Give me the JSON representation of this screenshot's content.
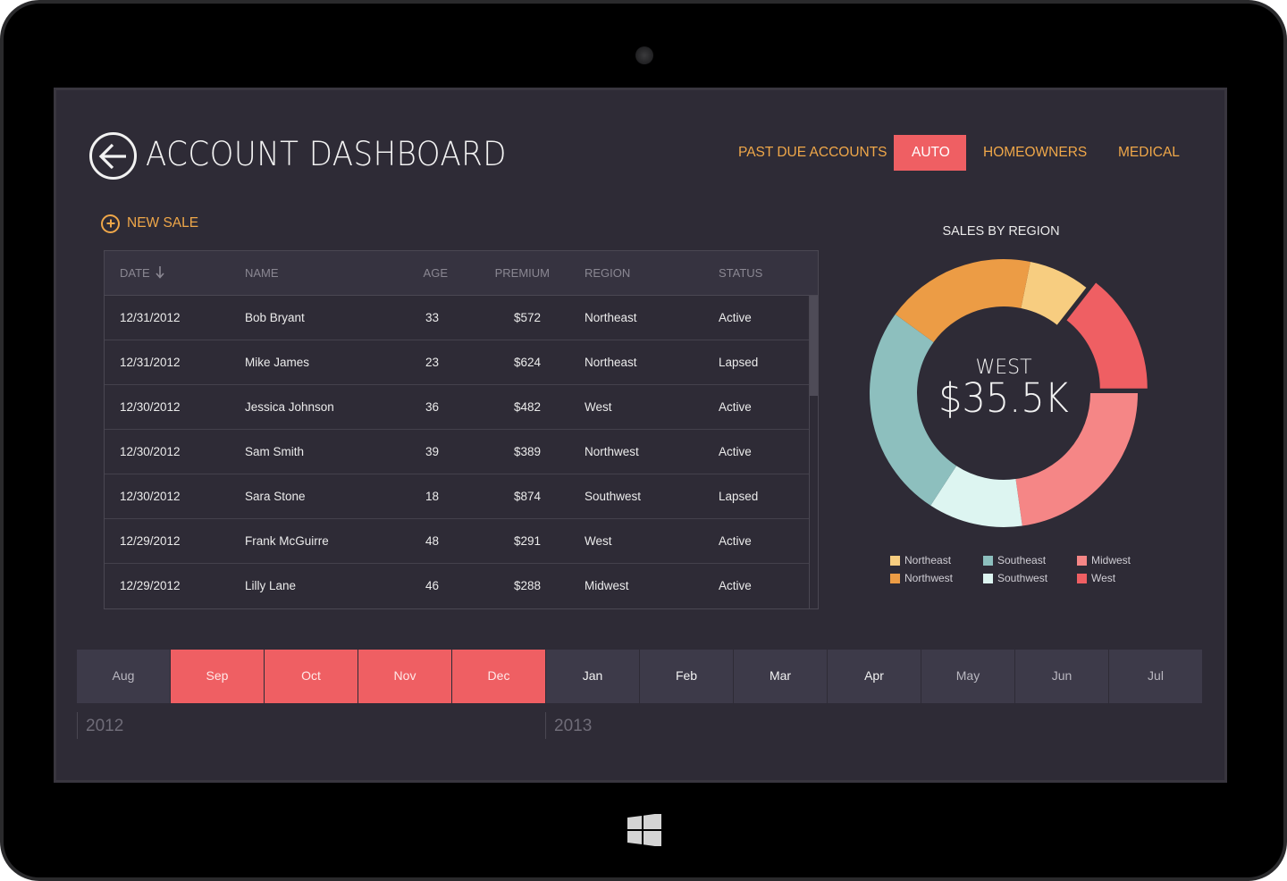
{
  "header": {
    "title": "ACCOUNT DASHBOARD",
    "back_icon": "arrow-left-circle-icon"
  },
  "nav": {
    "items": [
      {
        "label": "PAST DUE ACCOUNTS",
        "active": false
      },
      {
        "label": "AUTO",
        "active": true
      },
      {
        "label": "HOMEOWNERS",
        "active": false
      },
      {
        "label": "MEDICAL",
        "active": false
      }
    ]
  },
  "actions": {
    "new_sale_label": "NEW SALE",
    "new_sale_icon": "plus-circle-icon"
  },
  "table": {
    "columns": {
      "date": "DATE",
      "name": "NAME",
      "age": "AGE",
      "premium": "PREMIUM",
      "region": "REGION",
      "status": "STATUS"
    },
    "sort_icon": "arrow-down-icon",
    "rows": [
      {
        "date": "12/31/2012",
        "name": "Bob Bryant",
        "age": "33",
        "premium": "$572",
        "region": "Northeast",
        "status": "Active"
      },
      {
        "date": "12/31/2012",
        "name": "Mike James",
        "age": "23",
        "premium": "$624",
        "region": "Northeast",
        "status": "Lapsed"
      },
      {
        "date": "12/30/2012",
        "name": "Jessica Johnson",
        "age": "36",
        "premium": "$482",
        "region": "West",
        "status": "Active"
      },
      {
        "date": "12/30/2012",
        "name": "Sam Smith",
        "age": "39",
        "premium": "$389",
        "region": "Northwest",
        "status": "Active"
      },
      {
        "date": "12/30/2012",
        "name": "Sara Stone",
        "age": "18",
        "premium": "$874",
        "region": "Southwest",
        "status": "Lapsed"
      },
      {
        "date": "12/29/2012",
        "name": "Frank McGuirre",
        "age": "48",
        "premium": "$291",
        "region": "West",
        "status": "Active"
      },
      {
        "date": "12/29/2012",
        "name": "Lilly Lane",
        "age": "46",
        "premium": "$288",
        "region": "Midwest",
        "status": "Active"
      }
    ]
  },
  "chart_data": {
    "type": "pie",
    "variant": "donut",
    "title": "SALES BY REGION",
    "center_label": "WEST",
    "center_value": "$35.5K",
    "highlighted": "West",
    "start_angle_deg": 11.5,
    "unit": "$K",
    "slices": [
      {
        "name": "Northeast",
        "value": 18.1,
        "color": "#f7cd80"
      },
      {
        "name": "West",
        "value": 35.5,
        "color": "#ef5f63",
        "exploded": true
      },
      {
        "name": "Midwest",
        "value": 56.0,
        "color": "#f58686"
      },
      {
        "name": "Southwest",
        "value": 28.0,
        "color": "#ddf5f1"
      },
      {
        "name": "Southeast",
        "value": 63.5,
        "color": "#8dbfbe"
      },
      {
        "name": "Northwest",
        "value": 44.7,
        "color": "#ec9c45"
      }
    ],
    "legend": [
      [
        "Northeast",
        "Southeast",
        "Midwest"
      ],
      [
        "Northwest",
        "Southwest",
        "West"
      ]
    ],
    "legend_position": "bottom"
  },
  "timeline": {
    "months": [
      {
        "label": "Aug",
        "selected": false,
        "dim": true
      },
      {
        "label": "Sep",
        "selected": true
      },
      {
        "label": "Oct",
        "selected": true
      },
      {
        "label": "Nov",
        "selected": true
      },
      {
        "label": "Dec",
        "selected": true
      },
      {
        "label": "Jan",
        "selected": false
      },
      {
        "label": "Feb",
        "selected": false
      },
      {
        "label": "Mar",
        "selected": false
      },
      {
        "label": "Apr",
        "selected": false
      },
      {
        "label": "May",
        "selected": false,
        "dim": true
      },
      {
        "label": "Jun",
        "selected": false,
        "dim": true
      },
      {
        "label": "Jul",
        "selected": false,
        "dim": true
      }
    ],
    "years": [
      "2012",
      "2013"
    ]
  },
  "colors": {
    "accent": "#ef5f63",
    "link": "#efa749",
    "background": "#2e2b36"
  }
}
